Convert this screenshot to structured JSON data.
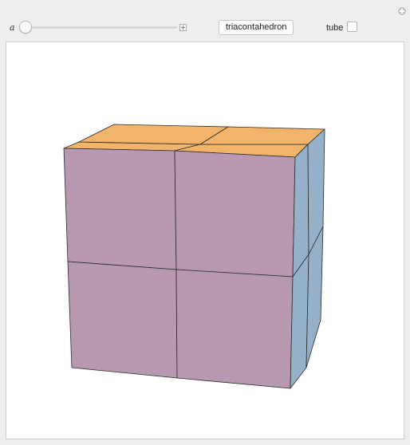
{
  "controls": {
    "slider_label": "a",
    "slider_value": 0,
    "shape_button_label": "triacontahedron",
    "tube_label": "tube",
    "tube_checked": false
  },
  "scene": {
    "object": "cube",
    "grid_divisions": 2,
    "face_colors": {
      "front": "#b898b0",
      "top": "#f2b36a",
      "right": "#95b0c9"
    },
    "edge_color": "#2a2a2a"
  }
}
